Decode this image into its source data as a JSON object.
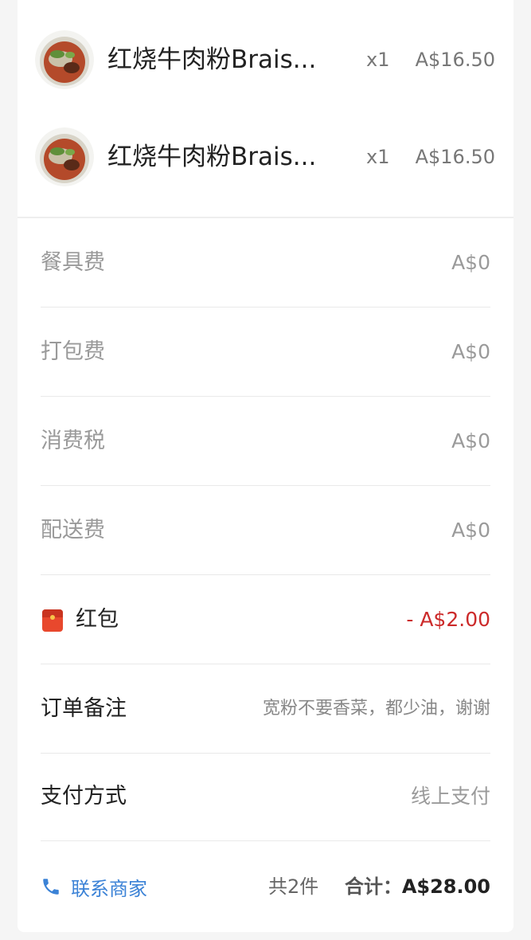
{
  "items": [
    {
      "name": "红烧牛肉粉Brais...",
      "qty": "x1",
      "price": "A$16.50",
      "image": "braised-beef-noodle-soup-photo"
    },
    {
      "name": "红烧牛肉粉Brais...",
      "qty": "x1",
      "price": "A$16.50",
      "image": "braised-beef-noodle-soup-photo"
    }
  ],
  "fees": {
    "tableware": {
      "label": "餐具费",
      "value": "A$0"
    },
    "packing": {
      "label": "打包费",
      "value": "A$0"
    },
    "tax": {
      "label": "消费税",
      "value": "A$0"
    },
    "delivery": {
      "label": "配送费",
      "value": "A$0"
    }
  },
  "red_packet": {
    "label": "红包",
    "value": "- A$2.00",
    "icon": "red-packet-icon"
  },
  "remark": {
    "label": "订单备注",
    "value": "宽粉不要香菜，都少油，谢谢"
  },
  "payment": {
    "label": "支付方式",
    "value": "线上支付"
  },
  "footer": {
    "contact_label": "联系商家",
    "contact_icon": "phone-icon",
    "count": "共2件",
    "total_label": "合计：",
    "total_value": "A$28.00"
  },
  "colors": {
    "accent_blue": "#3b82d6",
    "discount_red": "#cc2a2a"
  }
}
